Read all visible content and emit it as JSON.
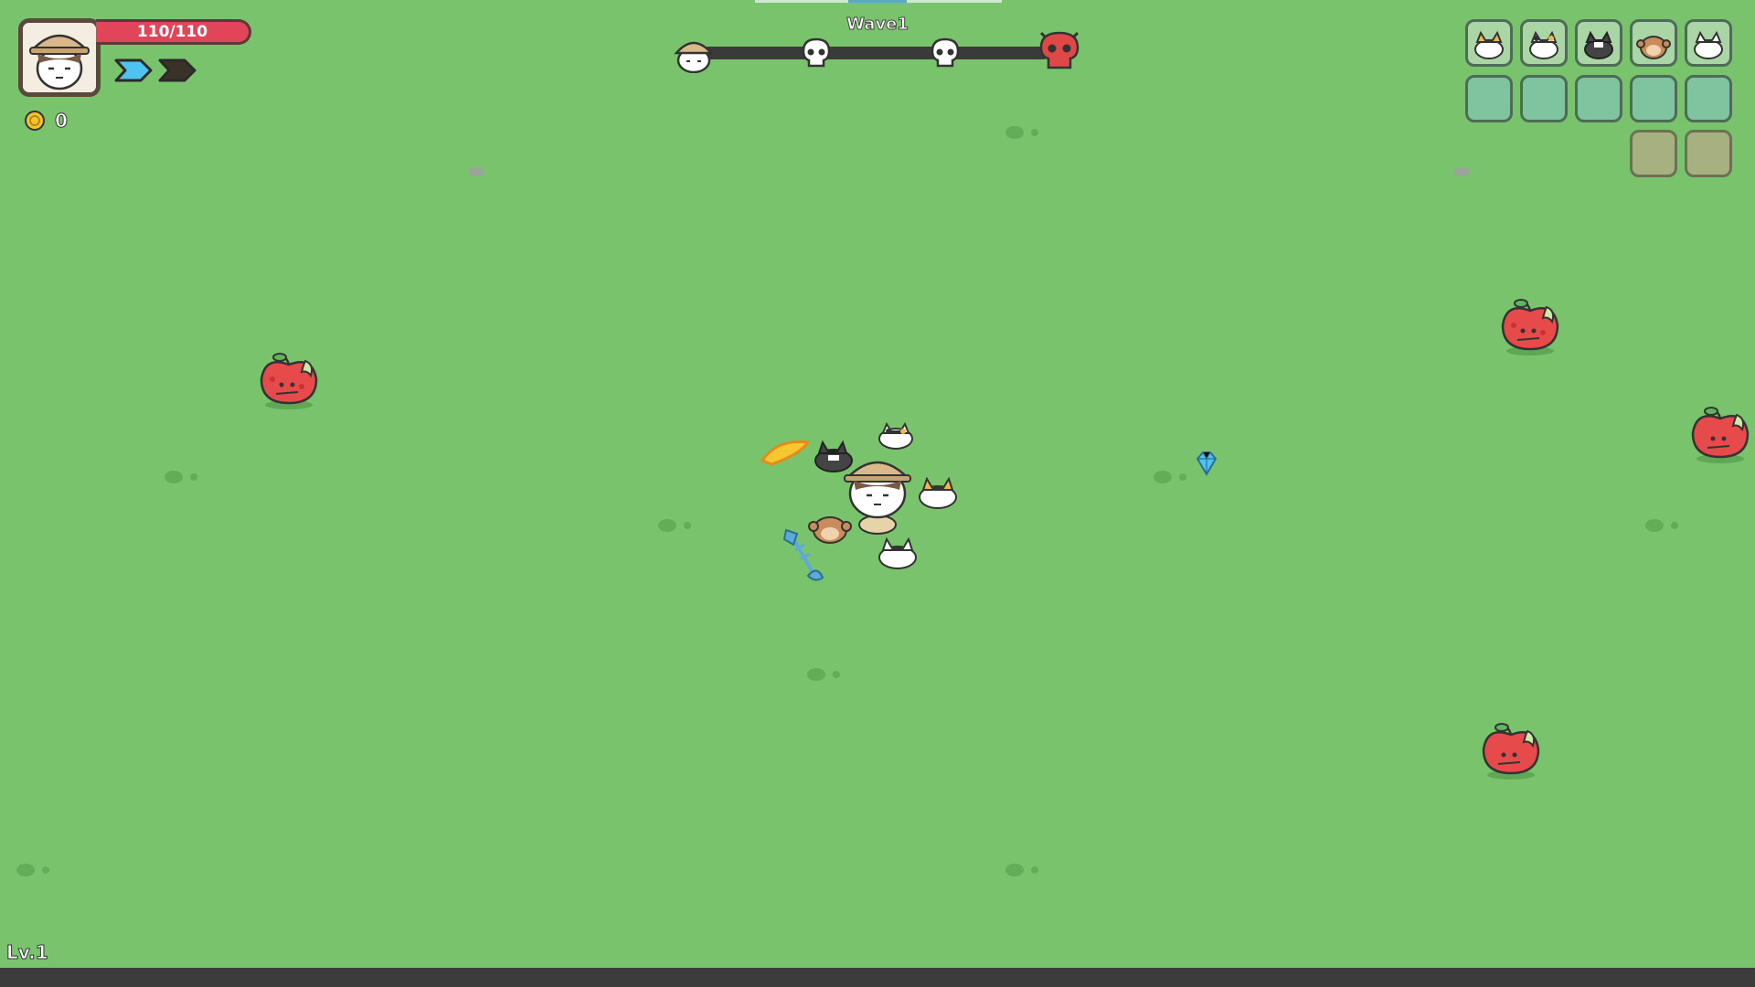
{
  "hud": {
    "player_avatar_icon": "explorer-portrait-icon",
    "hp_text": "110/110",
    "hp_fraction": 1.0,
    "dash_charges": [
      {
        "icon": "chevron-active-icon",
        "color": "#4fc3f0"
      },
      {
        "icon": "chevron-inactive-icon",
        "color": "#3a3226"
      }
    ],
    "coin_icon": "coin-icon",
    "coins": "0"
  },
  "wave": {
    "label": "Wave1",
    "markers": [
      {
        "icon": "player-head-icon"
      },
      {
        "icon": "skull-icon"
      },
      {
        "icon": "skull-icon"
      },
      {
        "icon": "boss-skull-icon",
        "color": "#e04848"
      }
    ]
  },
  "inventory": {
    "pets": [
      {
        "icon": "yellow-cat-icon"
      },
      {
        "icon": "calico-cat-icon"
      },
      {
        "icon": "black-cat-icon"
      },
      {
        "icon": "monkey-icon"
      },
      {
        "icon": "white-cat-icon"
      }
    ],
    "empty_slots": 5,
    "locked_slots": 2
  },
  "level": {
    "label": "Lv.1"
  },
  "world": {
    "enemies": [
      "apple-enemy-icon",
      "apple-enemy-icon",
      "apple-enemy-icon",
      "apple-enemy-icon"
    ],
    "pickups": [
      "blue-gem-icon"
    ],
    "companions": [
      "banana-weapon-icon",
      "black-cat-icon",
      "calico-cat-icon",
      "yellow-cat-icon",
      "monkey-icon",
      "white-cat-icon",
      "fish-bone-weapon-icon"
    ]
  },
  "colors": {
    "grass": "#79c36c",
    "hp": "#e0455a",
    "gem": "#4fc3f0"
  }
}
